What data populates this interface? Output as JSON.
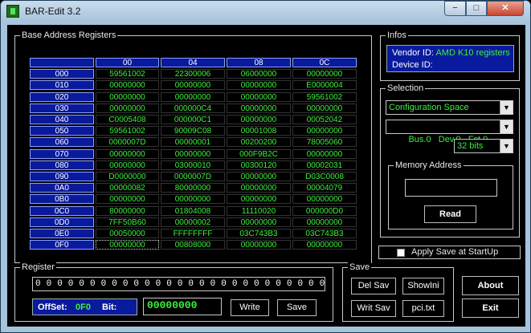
{
  "window": {
    "title": "BAR-Edit 3.2",
    "min_label": "−",
    "max_label": "□",
    "close_label": "✕"
  },
  "bar": {
    "title": "Base Address Registers",
    "columns": [
      "00",
      "04",
      "08",
      "0C"
    ],
    "rows": [
      {
        "off": "000",
        "v": [
          "59561002",
          "22300006",
          "06000000",
          "00000000"
        ]
      },
      {
        "off": "010",
        "v": [
          "00000000",
          "00000000",
          "00000000",
          "E0000004"
        ]
      },
      {
        "off": "020",
        "v": [
          "00000000",
          "00000000",
          "00000000",
          "59561002"
        ]
      },
      {
        "off": "030",
        "v": [
          "00000000",
          "000000C4",
          "00000000",
          "00000000"
        ]
      },
      {
        "off": "040",
        "v": [
          "C0005408",
          "000000C1",
          "00000000",
          "00052042"
        ]
      },
      {
        "off": "050",
        "v": [
          "59561002",
          "90009C08",
          "00001008",
          "00000000"
        ]
      },
      {
        "off": "060",
        "v": [
          "0000007D",
          "00000001",
          "00200200",
          "78005060"
        ]
      },
      {
        "off": "070",
        "v": [
          "00000000",
          "00000000",
          "000F9B2C",
          "00000000"
        ]
      },
      {
        "off": "080",
        "v": [
          "00000000",
          "03000010",
          "00300120",
          "00002031"
        ]
      },
      {
        "off": "090",
        "v": [
          "D0000000",
          "0000007D",
          "00000000",
          "D03C0008"
        ]
      },
      {
        "off": "0A0",
        "v": [
          "00000082",
          "80000000",
          "00000000",
          "00004079"
        ]
      },
      {
        "off": "0B0",
        "v": [
          "00000000",
          "00000000",
          "00000000",
          "00000000"
        ]
      },
      {
        "off": "0C0",
        "v": [
          "80000000",
          "01804008",
          "11110020",
          "000000D0"
        ]
      },
      {
        "off": "0D0",
        "v": [
          "7FF50B60",
          "00000002",
          "00000000",
          "00000000"
        ]
      },
      {
        "off": "0E0",
        "v": [
          "00050000",
          "FFFFFFFF",
          "03C743B3",
          "03C743B3"
        ]
      },
      {
        "off": "0F0",
        "v": [
          "00000000",
          "00808000",
          "00000000",
          "00000000"
        ]
      }
    ]
  },
  "infos": {
    "title": "Infos",
    "vendor_label": "Vendor ID:",
    "vendor_value": "AMD K10 registers",
    "device_label": "Device ID:"
  },
  "selection": {
    "title": "Selection",
    "space": "Configuration Space",
    "bus": "Bus.0   Dev.0   Fct.0",
    "width": "32 bits",
    "memory_title": "Memory Address",
    "read_label": "Read"
  },
  "apply_label": "Apply Save at StartUp",
  "register": {
    "title": "Register",
    "bits": "0 0 0 0 0 0 0 0 0 0 0 0 0 0 0 0 0 0 0 0 0 0 0 0 0 0 0 0 0 0 0 0",
    "offset_label": "OffSet:",
    "offset_value": "0F0",
    "bit_label": "Bit:",
    "data_value": "00000000",
    "write_label": "Write",
    "save_label": "Save"
  },
  "save": {
    "title": "Save",
    "del_sav": "Del Sav",
    "show_ini": "ShowIni",
    "writ_sav": "Writ Sav",
    "pci_txt": "pci.txt"
  },
  "about_label": "About",
  "exit_label": "Exit"
}
